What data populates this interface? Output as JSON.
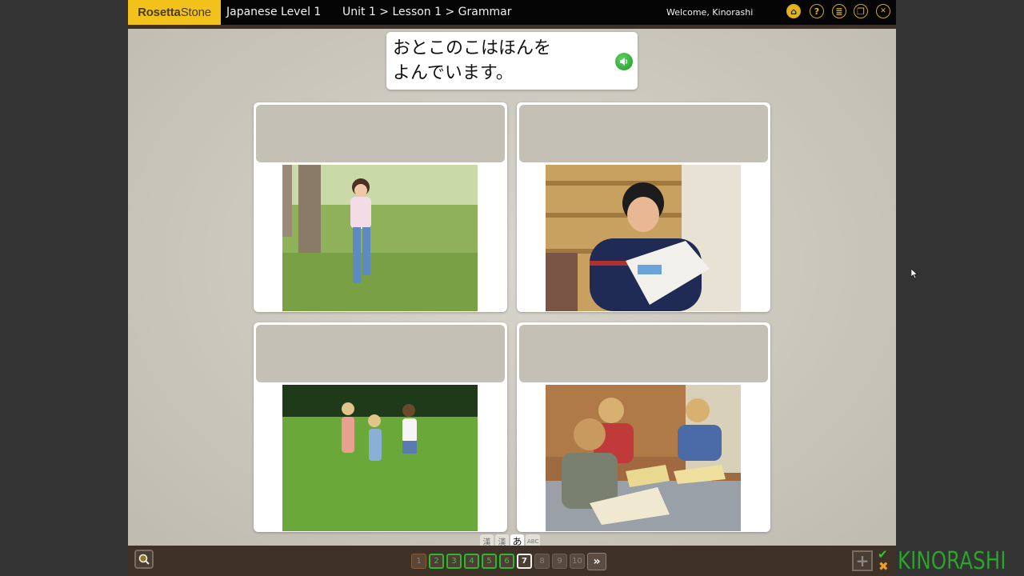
{
  "topbar": {
    "logo_bold": "Rosetta",
    "logo_light": "Stone",
    "course_title": "Japanese Level 1",
    "breadcrumb": "Unit 1 > Lesson 1 > Grammar",
    "welcome": "Welcome, Kinorashi",
    "icons": [
      {
        "name": "home-icon",
        "glyph": "⌂"
      },
      {
        "name": "help-icon",
        "glyph": "?"
      },
      {
        "name": "menu-list-icon",
        "glyph": "≣"
      },
      {
        "name": "window-restore-icon",
        "glyph": "❐"
      },
      {
        "name": "close-icon",
        "glyph": "✕"
      }
    ]
  },
  "prompt": {
    "text_line1": "おとこのこはほんを",
    "text_line2": "よんでいます。",
    "speaker_glyph": "🔊"
  },
  "cards": [
    {
      "name": "card-girl-running",
      "description": "Girl running on grass"
    },
    {
      "name": "card-boy-reading",
      "description": "Boy reading a book in library"
    },
    {
      "name": "card-children-running",
      "description": "Children running in field"
    },
    {
      "name": "card-boys-reading-table",
      "description": "Boys reading books at table"
    }
  ],
  "script_modes": [
    {
      "label": "漢",
      "state": "inactive"
    },
    {
      "label": "漢",
      "state": "inactive"
    },
    {
      "label": "あ",
      "state": "active"
    },
    {
      "label": "ABC",
      "state": "inactive"
    }
  ],
  "pages": [
    {
      "label": "1",
      "state": "visited"
    },
    {
      "label": "2",
      "state": "done"
    },
    {
      "label": "3",
      "state": "done"
    },
    {
      "label": "4",
      "state": "done"
    },
    {
      "label": "5",
      "state": "done"
    },
    {
      "label": "6",
      "state": "done"
    },
    {
      "label": "7",
      "state": "current"
    },
    {
      "label": "8",
      "state": "locked"
    },
    {
      "label": "9",
      "state": "locked"
    },
    {
      "label": "10",
      "state": "locked"
    }
  ],
  "next_label": "»",
  "score": {
    "correct_glyph": "✔",
    "incorrect_glyph": "✖"
  },
  "plus_glyph": "+",
  "watermark": "KINORASHI",
  "colors": {
    "brand_yellow": "#f2c21a",
    "done_green": "#2fb52f",
    "bar_brown": "#3d3128"
  }
}
